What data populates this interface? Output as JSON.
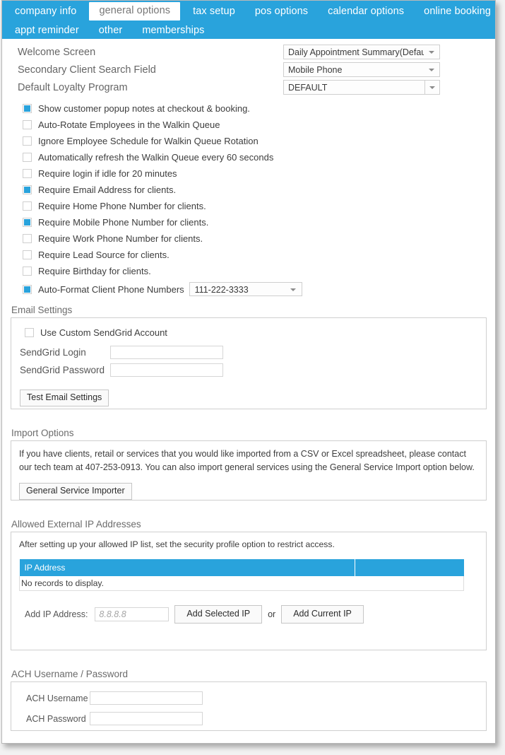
{
  "tabs": {
    "row1": [
      {
        "label": "company info",
        "active": false
      },
      {
        "label": "general options",
        "active": true
      },
      {
        "label": "tax setup",
        "active": false
      },
      {
        "label": "pos options",
        "active": false
      },
      {
        "label": "calendar options",
        "active": false
      },
      {
        "label": "online booking",
        "active": false
      }
    ],
    "row2": [
      {
        "label": "appt reminder",
        "active": false
      },
      {
        "label": "other",
        "active": false
      },
      {
        "label": "memberships",
        "active": false
      }
    ]
  },
  "top_settings": [
    {
      "label": "Welcome Screen",
      "value": "Daily Appointment Summary(Default",
      "split": false
    },
    {
      "label": "Secondary Client Search Field",
      "value": "Mobile Phone",
      "split": false
    },
    {
      "label": "Default Loyalty Program",
      "value": "DEFAULT",
      "split": true
    }
  ],
  "checkboxes": [
    {
      "label": "Show customer popup notes at checkout & booking.",
      "checked": true
    },
    {
      "label": "Auto-Rotate Employees in the Walkin Queue",
      "checked": false
    },
    {
      "label": "Ignore Employee Schedule for Walkin Queue Rotation",
      "checked": false
    },
    {
      "label": "Automatically refresh the Walkin Queue every 60 seconds",
      "checked": false
    },
    {
      "label": "Require login if idle for 20 minutes",
      "checked": false
    },
    {
      "label": "Require Email Address for clients.",
      "checked": true
    },
    {
      "label": "Require Home Phone Number for clients.",
      "checked": false
    },
    {
      "label": "Require Mobile Phone Number for clients.",
      "checked": true
    },
    {
      "label": "Require Work Phone Number for clients.",
      "checked": false
    },
    {
      "label": "Require Lead Source for clients.",
      "checked": false
    },
    {
      "label": "Require Birthday for clients.",
      "checked": false
    }
  ],
  "phone_format": {
    "label": "Auto-Format Client Phone Numbers",
    "checked": true,
    "value": "111-222-3333"
  },
  "email_settings": {
    "title": "Email Settings",
    "custom_account": {
      "label": "Use Custom SendGrid Account",
      "checked": false
    },
    "login_label": "SendGrid Login",
    "login_value": "",
    "password_label": "SendGrid Password",
    "password_value": "",
    "test_button": "Test Email Settings"
  },
  "import_options": {
    "title": "Import Options",
    "description": "If you have clients, retail or services that you would like imported from a CSV or Excel spreadsheet, please contact our tech team at 407-253-0913. You can also import general services using the General Service Import option below.",
    "button": "General Service Importer"
  },
  "ip_addresses": {
    "title": "Allowed External IP Addresses",
    "hint": "After setting up your allowed IP list, set the security profile option to restrict access.",
    "columns": [
      "IP Address",
      ""
    ],
    "rows": [],
    "empty_message": "No records to display.",
    "add_label": "Add IP Address:",
    "add_placeholder": "8.8.8.8",
    "add_value": "",
    "add_selected_button": "Add Selected IP",
    "or_text": "or",
    "add_current_button": "Add Current IP"
  },
  "ach": {
    "title": "ACH Username / Password",
    "username_label": "ACH Username",
    "username_value": "",
    "password_label": "ACH Password",
    "password_value": ""
  },
  "colors": {
    "accent": "#29a3dc",
    "label_text": "#666666",
    "body_text": "#3d3d3d"
  }
}
